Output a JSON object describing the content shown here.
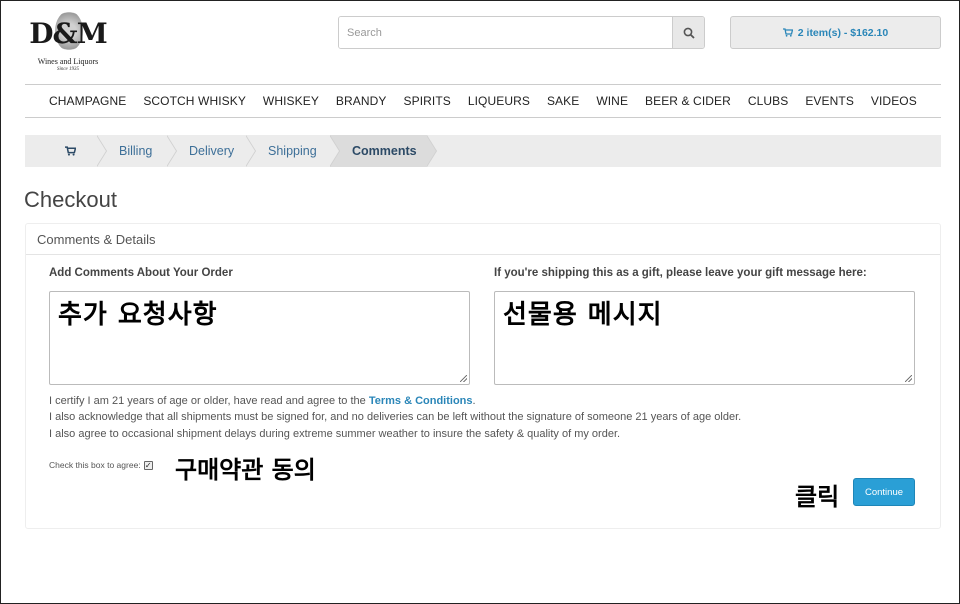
{
  "logo": {
    "mark": "D&M",
    "tagline": "Wines and Liquors",
    "since": "Since 1935"
  },
  "search": {
    "placeholder": "Search",
    "icon": "search-icon"
  },
  "cart": {
    "label": "2 item(s) - $162.10",
    "icon": "shopping-cart-icon"
  },
  "nav": [
    "CHAMPAGNE",
    "SCOTCH WHISKY",
    "WHISKEY",
    "BRANDY",
    "SPIRITS",
    "LIQUEURS",
    "SAKE",
    "WINE",
    "BEER & CIDER",
    "CLUBS",
    "EVENTS",
    "VIDEOS"
  ],
  "breadcrumb": {
    "cart_icon": "shopping-cart-icon",
    "steps": [
      "Billing",
      "Delivery",
      "Shipping",
      "Comments"
    ],
    "active": "Comments"
  },
  "page": {
    "title": "Checkout",
    "panel_title": "Comments & Details"
  },
  "form": {
    "comments_label": "Add Comments About Your Order",
    "comments_value": "추가 요청사항",
    "gift_label": "If you're shipping this as a gift, please leave your gift message here:",
    "gift_value": "선물용 메시지",
    "terms_line1_pre": "I certify I am 21 years of age or older, have read and agree to the ",
    "terms_link": "Terms & Conditions",
    "terms_line1_post": ".",
    "terms_line2": "I also acknowledge that all shipments must be signed for, and no deliveries can be left without the signature of someone 21 years of age older.",
    "terms_line3": "I also agree to occasional shipment delays during extreme summer weather to insure the safety & quality of my order.",
    "agree_label": "Check this box to agree:",
    "agree_checked": true,
    "agree_note": "구매약관 동의",
    "click_note": "클릭",
    "continue_label": "Continue"
  },
  "colors": {
    "accent": "#2a86b8",
    "button": "#2a9fd6"
  }
}
